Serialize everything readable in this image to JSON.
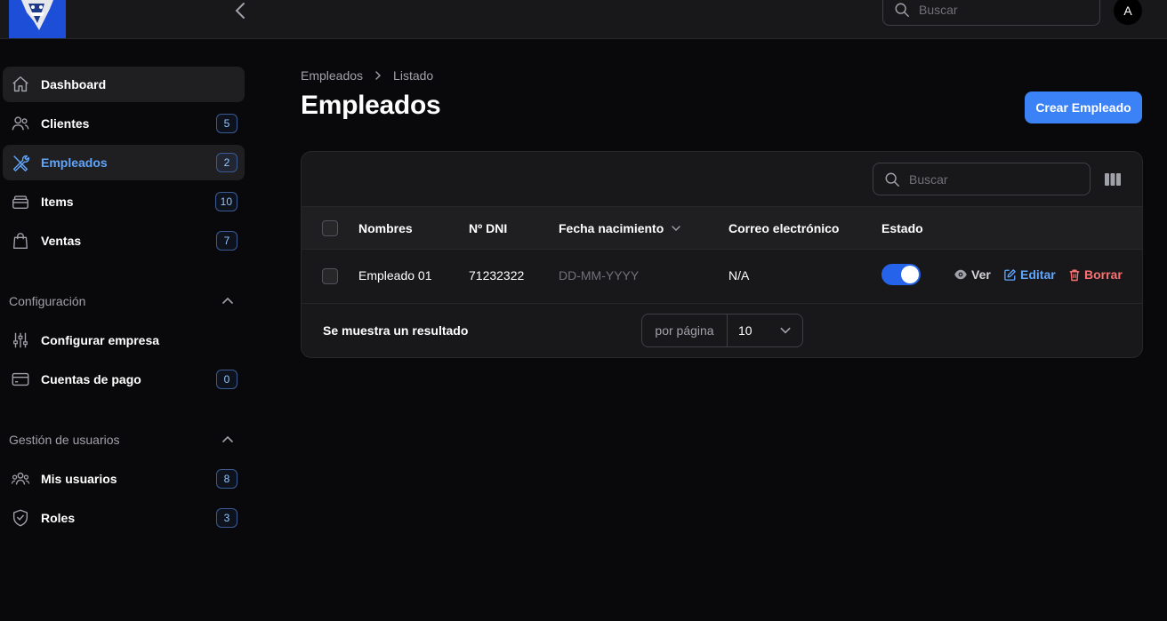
{
  "topbar": {
    "search_placeholder": "Buscar",
    "avatar_initial": "A"
  },
  "sidebar": {
    "items": [
      {
        "label": "Dashboard",
        "icon": "home-icon",
        "badge": null
      },
      {
        "label": "Clientes",
        "icon": "users-icon",
        "badge": "5"
      },
      {
        "label": "Empleados",
        "icon": "wrench-screwdriver-icon",
        "badge": "2"
      },
      {
        "label": "Items",
        "icon": "stack-icon",
        "badge": "10"
      },
      {
        "label": "Ventas",
        "icon": "shopping-bag-icon",
        "badge": "7"
      }
    ],
    "groups": [
      {
        "label": "Configuración",
        "items": [
          {
            "label": "Configurar empresa",
            "icon": "sliders-icon",
            "badge": null
          },
          {
            "label": "Cuentas de pago",
            "icon": "credit-card-icon",
            "badge": "0"
          }
        ]
      },
      {
        "label": "Gestión de usuarios",
        "items": [
          {
            "label": "Mis usuarios",
            "icon": "user-group-icon",
            "badge": "8"
          },
          {
            "label": "Roles",
            "icon": "shield-check-icon",
            "badge": "3"
          }
        ]
      }
    ]
  },
  "breadcrumb": [
    "Empleados",
    "Listado"
  ],
  "page": {
    "title": "Empleados",
    "create_button": "Crear Empleado"
  },
  "table": {
    "search_placeholder": "Buscar",
    "columns": [
      "Nombres",
      "Nº DNI",
      "Fecha nacimiento",
      "Correo electrónico",
      "Estado"
    ],
    "rows": [
      {
        "nombres": "Empleado 01",
        "dni": "71232322",
        "fecha": "DD-MM-YYYY",
        "correo": "N/A",
        "estado": true,
        "actions": {
          "view": "Ver",
          "edit": "Editar",
          "delete": "Borrar"
        }
      }
    ],
    "footer_text": "Se muestra un resultado",
    "per_page_label": "por página",
    "per_page_value": "10"
  },
  "colors": {
    "accent": "#3b82f6",
    "danger": "#f87171",
    "link": "#60a5fa"
  }
}
